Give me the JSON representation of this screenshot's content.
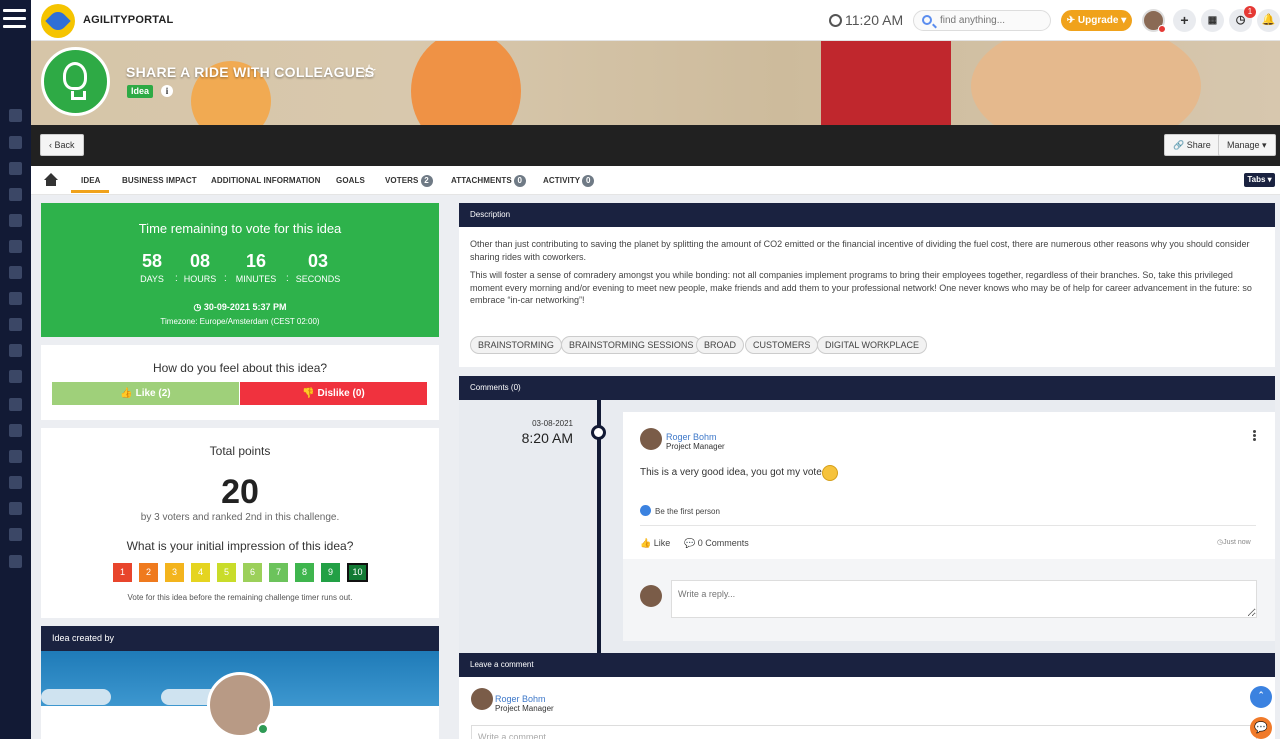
{
  "topbar": {
    "brand": "AGILITYPORTAL",
    "time": "11:20 AM",
    "search_placeholder": "find anything...",
    "upgrade_label": "Upgrade",
    "notification_count": "1"
  },
  "header": {
    "title": "SHARE A RIDE WITH COLLEAGUES",
    "type_badge": "Idea"
  },
  "actions": {
    "back_label": "Back",
    "share_label": "Share",
    "manage_label": "Manage"
  },
  "tabs": [
    {
      "label": "IDEA"
    },
    {
      "label": "BUSINESS IMPACT"
    },
    {
      "label": "ADDITIONAL INFORMATION"
    },
    {
      "label": "GOALS"
    },
    {
      "label": "VOTERS",
      "count": "2"
    },
    {
      "label": "ATTACHMENTS",
      "count": "0"
    },
    {
      "label": "ACTIVITY",
      "count": "0"
    }
  ],
  "tabs_dropdown": "Tabs",
  "timer": {
    "title": "Time remaining to vote for this idea",
    "days": "58",
    "days_label": "DAYS",
    "hours": "08",
    "hours_label": "HOURS",
    "minutes": "16",
    "minutes_label": "MINUTES",
    "seconds": "03",
    "seconds_label": "SECONDS",
    "deadline": "30-09-2021 5:37 PM",
    "timezone": "Timezone: Europe/Amsterdam (CEST 02:00)"
  },
  "feel": {
    "question": "How do you feel about this idea?",
    "like_label": "Like (2)",
    "dislike_label": "Dislike (0)"
  },
  "points": {
    "label": "Total points",
    "value": "20",
    "subtitle": "by 3 voters and ranked 2nd in this challenge.",
    "question": "What is your initial impression of this idea?",
    "scale": [
      "1",
      "2",
      "3",
      "4",
      "5",
      "6",
      "7",
      "8",
      "9",
      "10"
    ],
    "selected": "10",
    "note": "Vote for this idea before the remaining challenge timer runs out."
  },
  "creator": {
    "header": "Idea created by"
  },
  "description": {
    "header": "Description",
    "p1": "Other than just contributing to saving the planet by splitting the amount of CO2 emitted or the financial incentive of dividing the fuel cost, there are numerous other reasons why you should consider sharing rides with coworkers.",
    "p2": "This will foster a sense of comradery amongst you while bonding: not all companies implement programs to bring their employees together, regardless of their branches. So, take this privileged moment every morning and/or evening to meet new people, make friends and add them to your professional network! One never knows who may be of help for career advancement in the future: so embrace “in-car networking”!",
    "tags": [
      "BRAINSTORMING",
      "BRAINSTORMING SESSIONS",
      "BROAD",
      "CUSTOMERS",
      "DIGITAL WORKPLACE"
    ]
  },
  "comments": {
    "header": "Comments (0)",
    "date": "03-08-2021",
    "time": "8:20 AM",
    "author": "Roger Bohm",
    "role": "Project Manager",
    "text": "This is a very good idea, you got my vote.",
    "first": "Be the first person",
    "like": "Like",
    "comments_count": "0 Comments",
    "ago": "Just now",
    "reply_placeholder": "Write a reply..."
  },
  "leave": {
    "header": "Leave a comment",
    "author": "Roger Bohm",
    "role": "Project Manager",
    "placeholder": "Write a comment..."
  },
  "colors": {
    "navy": "#1a2240",
    "green": "#2eb24b",
    "orange": "#f0a21b",
    "red": "#f0323e"
  }
}
